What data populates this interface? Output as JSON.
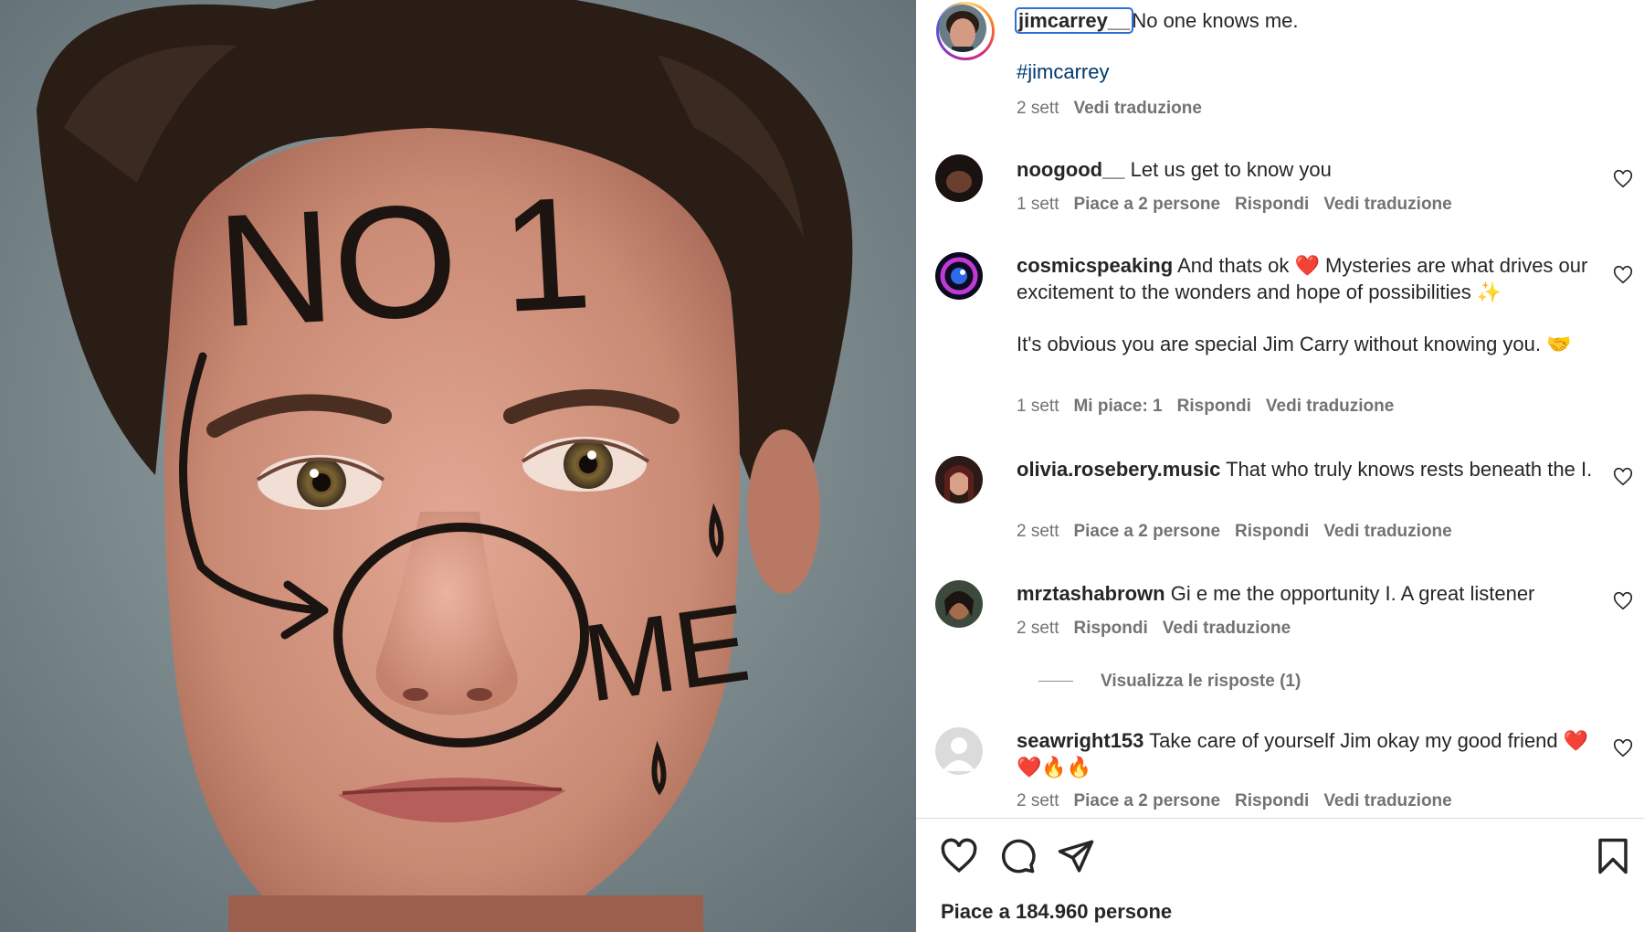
{
  "post": {
    "author": "jimcarrey__",
    "caption": "No one knows me.",
    "hashtag": "#jimcarrey",
    "time": "2 sett",
    "translate": "Vedi traduzione",
    "photo_writing": {
      "forehead": "NO 1",
      "cheek": "ME"
    }
  },
  "comments": [
    {
      "username": "noogood__",
      "text": "Let us get to know you",
      "time": "1 sett",
      "likes": "Piace a 2 persone",
      "reply": "Rispondi",
      "translate": "Vedi traduzione"
    },
    {
      "username": "cosmicspeaking",
      "text": "And thats ok ❤️ Mysteries are what drives our excitement to the wonders and hope of possibilities ✨",
      "text2": "It's obvious you are special Jim Carry without knowing you. 🤝",
      "time": "1 sett",
      "likes": "Mi piace: 1",
      "reply": "Rispondi",
      "translate": "Vedi traduzione"
    },
    {
      "username": "olivia.rosebery.music",
      "text": "That who truly knows rests beneath the I.",
      "time": "2 sett",
      "likes": "Piace a 2 persone",
      "reply": "Rispondi",
      "translate": "Vedi traduzione"
    },
    {
      "username": "mrztashabrown",
      "text": "Gi e me the opportunity I. A great listener",
      "time": "2 sett",
      "reply": "Rispondi",
      "translate": "Vedi traduzione",
      "view_replies": "Visualizza le risposte (1)"
    },
    {
      "username": "seawright153",
      "text": "Take care of yourself Jim okay my good friend ❤️❤️🔥🔥",
      "time": "2 sett",
      "likes": "Piace a 2 persone",
      "reply": "Rispondi",
      "translate": "Vedi traduzione"
    }
  ],
  "actions": {
    "like": "heart-icon",
    "comment": "comment-icon",
    "share": "paper-plane-icon",
    "save": "bookmark-icon"
  },
  "likes_summary": "Piace a 184.960 persone",
  "colors": {
    "username_highlight": "#2e6fd8",
    "hashtag": "#00376b",
    "secondary_text": "#737373",
    "divider": "#dbdbdb"
  }
}
